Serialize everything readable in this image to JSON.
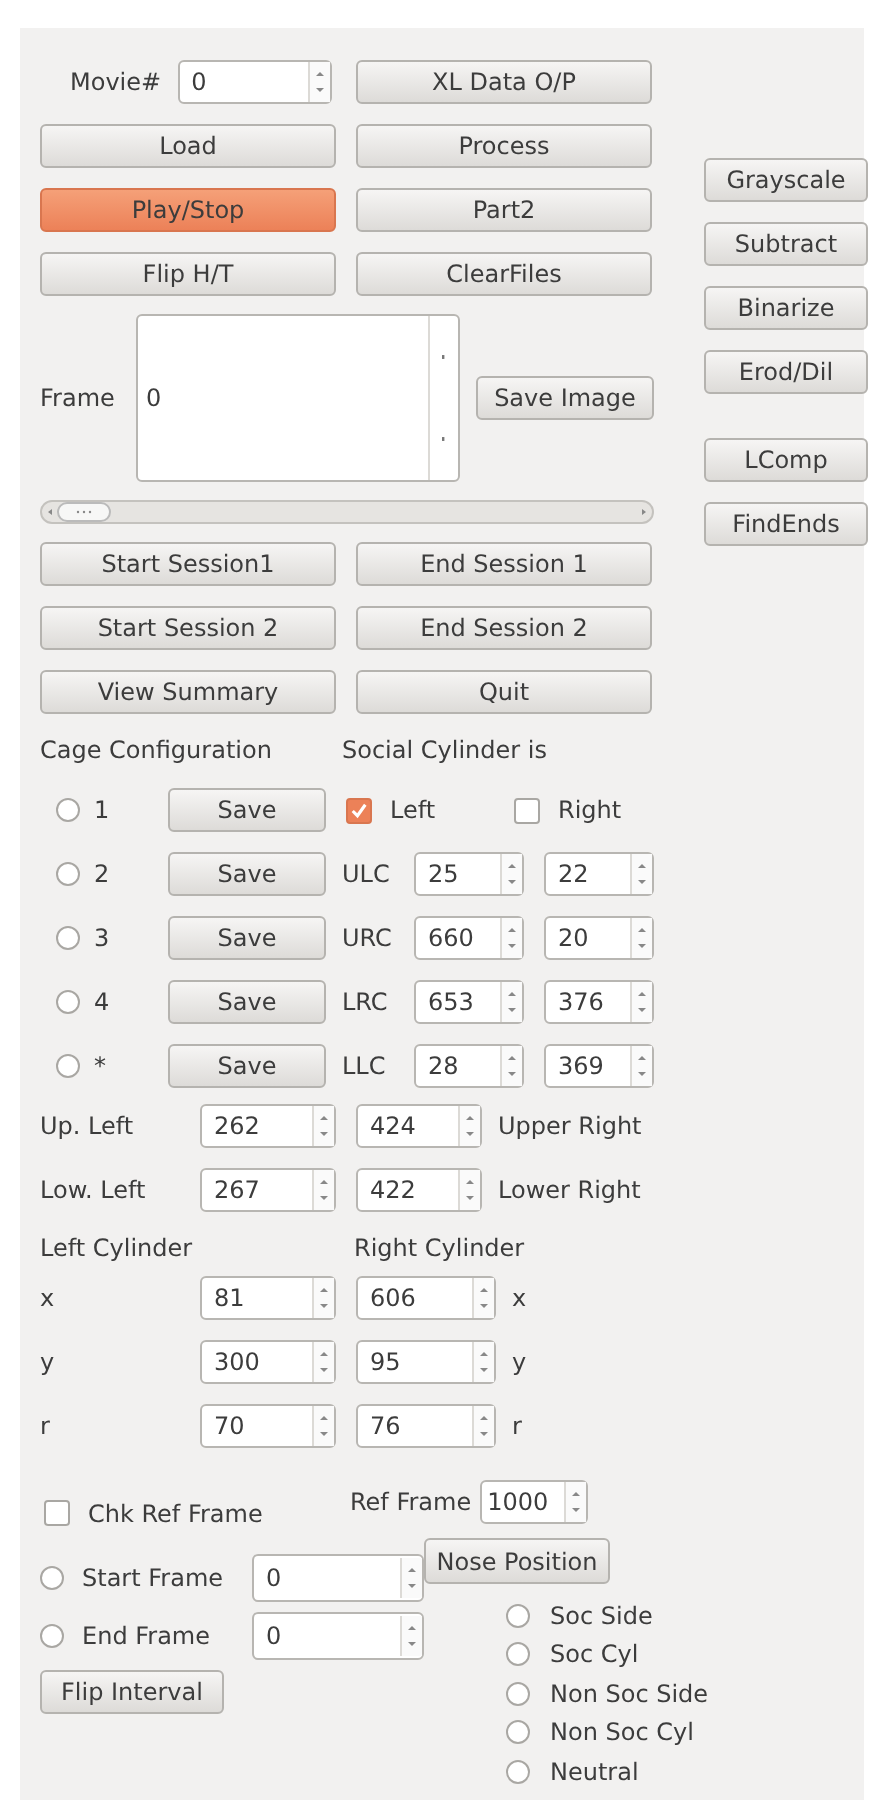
{
  "movie": {
    "label": "Movie#",
    "value": "0"
  },
  "buttons": [
    {
      "label": "XL Data O/P",
      "highlighted": false
    },
    {
      "label": "Load",
      "highlighted": false
    },
    {
      "label": "Process",
      "highlighted": false
    },
    {
      "label": "Play/Stop",
      "highlighted": true
    },
    {
      "label": "Part2",
      "highlighted": false
    },
    {
      "label": "Flip H/T",
      "highlighted": false
    },
    {
      "label": "ClearFiles",
      "highlighted": false
    }
  ],
  "side_buttons": [
    [
      "Grayscale",
      "Subtract",
      "Binarize",
      "Erod/Dil"
    ],
    [
      "LComp",
      "FindEnds"
    ]
  ],
  "frame": {
    "label": "Frame",
    "value": "0",
    "button": "Save Image"
  },
  "session_buttons": [
    "Start Session1",
    "End Session 1",
    "Start Session 2",
    "End Session 2",
    "View Summary",
    "Quit"
  ],
  "cage": {
    "title": "Cage Configuration",
    "configs": [
      {
        "label": "1",
        "selected": false,
        "button": "Save"
      },
      {
        "label": "2",
        "selected": false,
        "button": "Save"
      },
      {
        "label": "3",
        "selected": false,
        "button": "Save"
      },
      {
        "label": "4",
        "selected": false,
        "button": "Save"
      },
      {
        "label": "*",
        "selected": false,
        "button": "Save"
      }
    ]
  },
  "social": {
    "title": "Social Cylinder is",
    "options": [
      {
        "label": "Left",
        "checked": true
      },
      {
        "label": "Right",
        "checked": false
      }
    ],
    "corners": [
      {
        "label": "ULC",
        "values": [
          "25",
          "22"
        ]
      },
      {
        "label": "URC",
        "values": [
          "660",
          "20"
        ]
      },
      {
        "label": "LRC",
        "values": [
          "653",
          "376"
        ]
      },
      {
        "label": "LLC",
        "values": [
          "28",
          "369"
        ]
      }
    ]
  },
  "bounds": [
    {
      "label": "Up. Left",
      "values": [
        "262",
        "424"
      ],
      "label_right": "Upper Right"
    },
    {
      "label": "Low. Left",
      "values": [
        "267",
        "422"
      ],
      "label_right": "Lower Right"
    }
  ],
  "cylinders": {
    "left_title": "Left Cylinder",
    "right_title": "Right Cylinder",
    "rows": [
      {
        "label": "x",
        "values": [
          "81",
          "606"
        ],
        "label_right": "x"
      },
      {
        "label": "y",
        "values": [
          "300",
          "95"
        ],
        "label_right": "y"
      },
      {
        "label": "r",
        "values": [
          "70",
          "76"
        ],
        "label_right": "r"
      }
    ]
  },
  "ref": {
    "check_label": "Chk Ref Frame",
    "checked": false,
    "frame_label": "Ref Frame",
    "frame_value": "1000"
  },
  "interval": [
    {
      "label": "Start Frame",
      "selected": false,
      "value": "0"
    },
    {
      "label": "End Frame",
      "selected": false,
      "value": "0"
    }
  ],
  "flip_button": "Flip Interval",
  "nose": {
    "button": "Nose Position",
    "options": [
      {
        "label": "Soc Side",
        "selected": false
      },
      {
        "label": "Soc Cyl",
        "selected": false
      },
      {
        "label": "Non Soc Side",
        "selected": false
      },
      {
        "label": "Non Soc Cyl",
        "selected": false
      },
      {
        "label": "Neutral",
        "selected": false
      }
    ]
  }
}
